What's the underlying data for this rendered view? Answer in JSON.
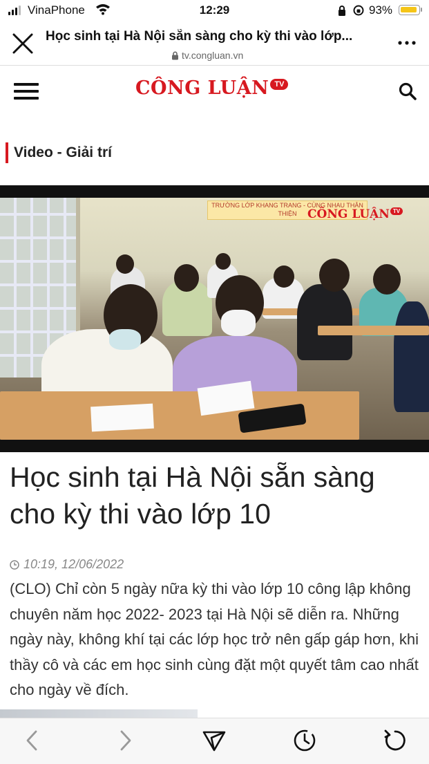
{
  "status_bar": {
    "carrier": "VinaPhone",
    "time": "12:29",
    "battery_percent": "93%",
    "battery_level": 0.93
  },
  "browser": {
    "page_title": "Học sinh tại Hà Nội sẵn sàng cho kỳ thi vào lớp...",
    "url": "tv.congluan.vn"
  },
  "site": {
    "logo_text": "CÔNG LUẬN",
    "logo_badge": "TV",
    "category": "Video - Giải trí"
  },
  "video": {
    "banner_text": "TRƯỜNG LỚP KHANG TRANG - CÙNG NHAU THÂN THIỆN",
    "watermark_text": "CÔNG LUẬN",
    "watermark_badge": "TV"
  },
  "article": {
    "title": "Học sinh tại Hà Nội sẵn sàng cho kỳ thi vào lớp 10",
    "timestamp": "10:19, 12/06/2022",
    "lead": "(CLO) Chỉ còn 5 ngày nữa kỳ thi vào lớp 10 công lập không chuyên năm học 2022- 2023 tại Hà Nội sẽ diễn ra. Những ngày này, không khí tại các lớp học trở nên gấp gáp hơn, khi thầy cô và các em học sinh cùng đặt một quyết tâm cao nhất cho ngày về đích."
  },
  "icons": {
    "signal": "signal-icon",
    "wifi": "wifi-icon",
    "close": "close-icon",
    "lock": "lock-icon",
    "more": "more-icon",
    "menu": "hamburger-icon",
    "search": "search-icon",
    "clock": "clock-icon",
    "back": "chevron-left-icon",
    "forward": "chevron-right-icon",
    "share": "send-icon",
    "history": "history-icon",
    "reload": "reload-icon"
  },
  "colors": {
    "brand": "#d71920",
    "battery": "#f5c518"
  }
}
